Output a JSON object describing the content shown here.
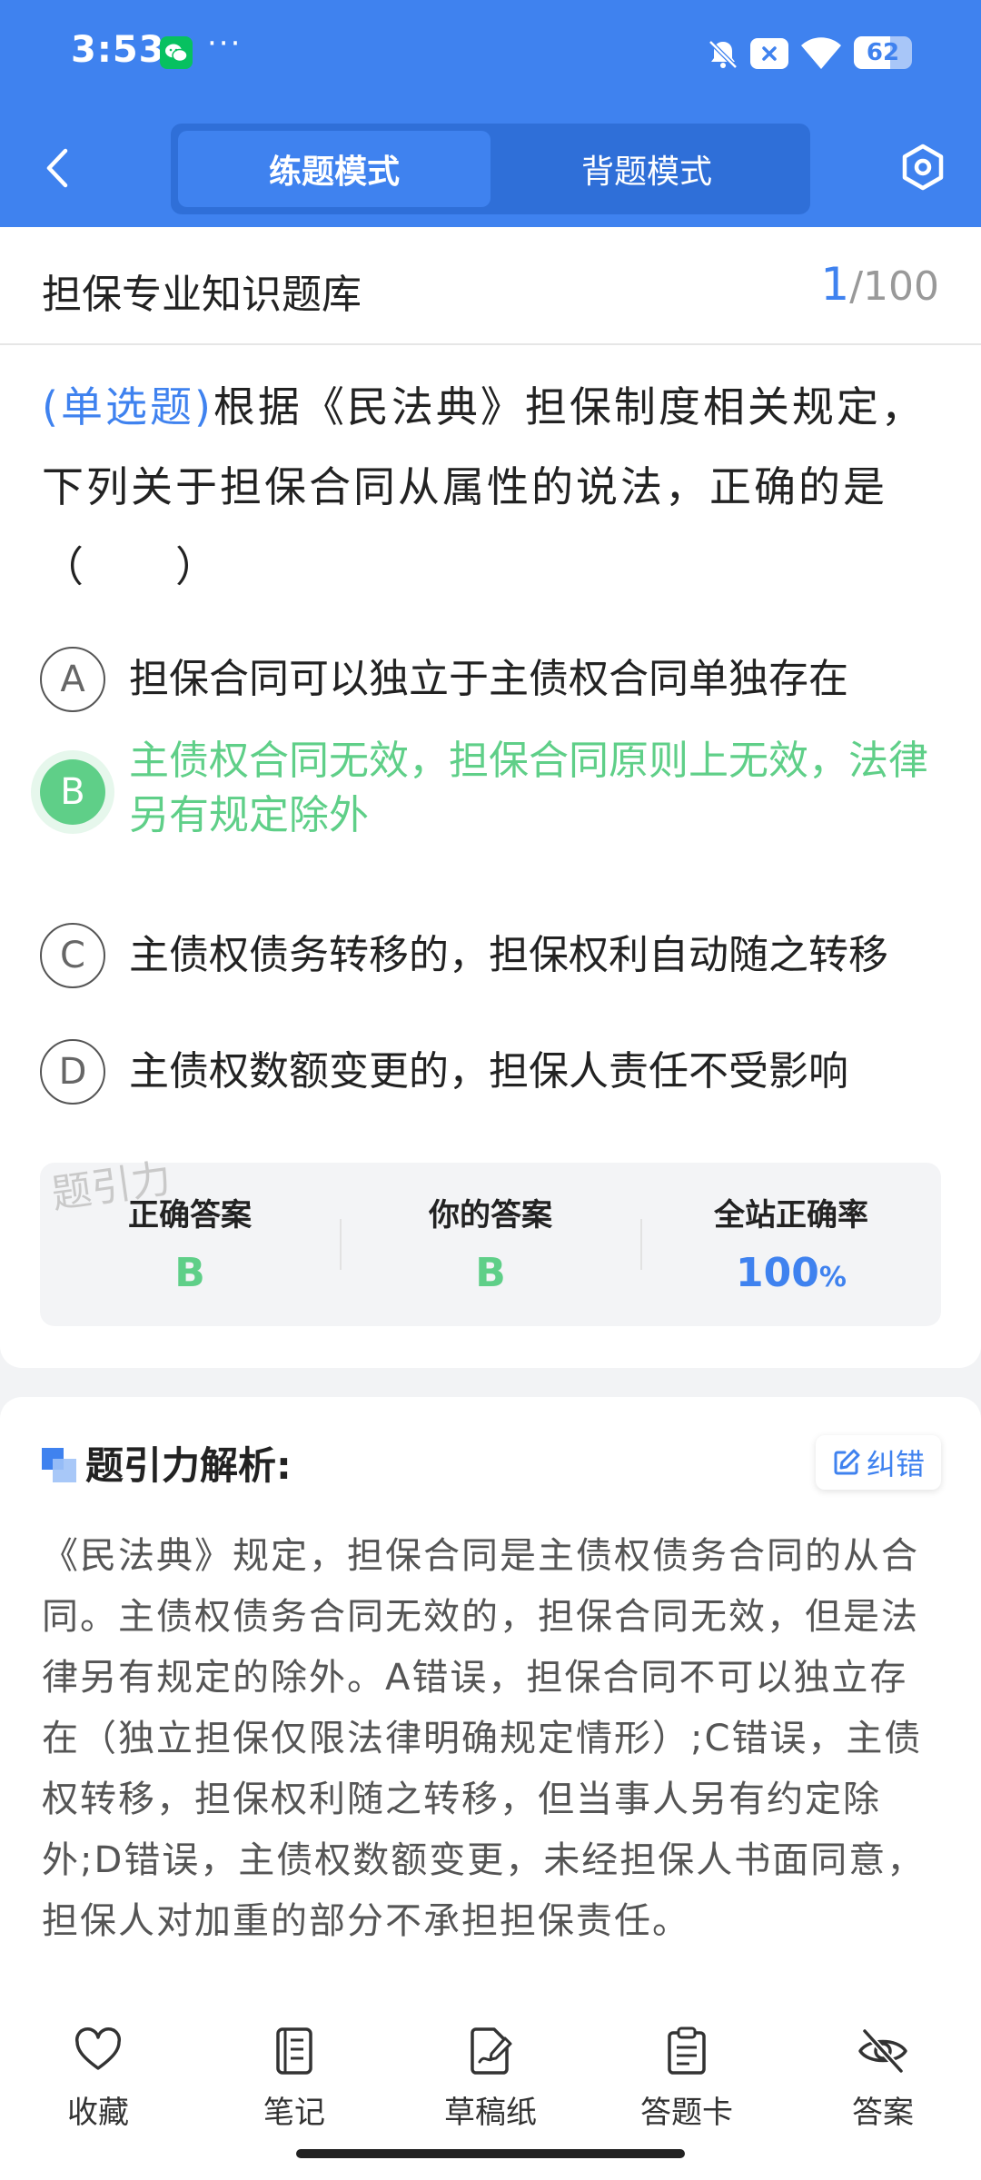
{
  "status_bar": {
    "time": "3:53",
    "more": "···",
    "battery_level": 62,
    "battery_text": "62"
  },
  "nav": {
    "tabs": [
      {
        "label": "练题模式",
        "active": true
      },
      {
        "label": "背题模式",
        "active": false
      }
    ]
  },
  "question_bank": {
    "title": "担保专业知识题库",
    "current": "1",
    "total": "/100"
  },
  "question": {
    "type_label": "(单选题)",
    "text": "根据《民法典》担保制度相关规定，下列关于担保合同从属性的说法，正确的是（　　）"
  },
  "options": [
    {
      "letter": "A",
      "text": "担保合同可以独立于主债权合同单独存在",
      "correct": false
    },
    {
      "letter": "B",
      "text": "主债权合同无效，担保合同原则上无效，法律另有规定除外",
      "correct": true
    },
    {
      "letter": "C",
      "text": "主债权债务转移的，担保权利自动随之转移",
      "correct": false
    },
    {
      "letter": "D",
      "text": "主债权数额变更的，担保人责任不受影响",
      "correct": false
    }
  ],
  "watermark": "题引力",
  "stats": {
    "correct_answer_label": "正确答案",
    "correct_answer": "B",
    "your_answer_label": "你的答案",
    "your_answer": "B",
    "rate_label": "全站正确率",
    "rate_value": "100",
    "rate_unit": "%"
  },
  "analysis": {
    "title": "题引力解析:",
    "report_label": "纠错",
    "text": "《民法典》规定，担保合同是主债权债务合同的从合同。主债权债务合同无效的，担保合同无效，但是法律另有规定的除外。A错误，担保合同不可以独立存在（独立担保仅限法律明确规定情形）;C错误，主债权转移，担保权利随之转移，但当事人另有约定除外;D错误，主债权数额变更，未经担保人书面同意，担保人对加重的部分不承担担保责任。"
  },
  "bottom_bar": [
    {
      "label": "收藏",
      "icon": "heart-icon"
    },
    {
      "label": "笔记",
      "icon": "notebook-icon"
    },
    {
      "label": "草稿纸",
      "icon": "draft-icon"
    },
    {
      "label": "答题卡",
      "icon": "clipboard-icon"
    },
    {
      "label": "答案",
      "icon": "eye-off-icon"
    }
  ],
  "colors": {
    "brand_blue": "#3f82ef",
    "correct_green": "#5fcf88"
  }
}
